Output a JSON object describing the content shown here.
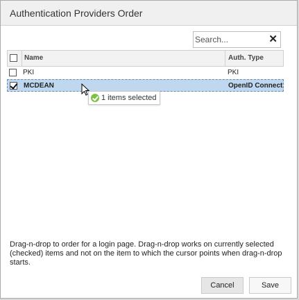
{
  "dialog": {
    "title": "Authentication Providers Order",
    "search_placeholder": "Search...",
    "clear_glyph": "✕"
  },
  "grid": {
    "columns": {
      "name": "Name",
      "type": "Auth. Type"
    },
    "rows": [
      {
        "name": "PKI",
        "type": "PKI",
        "checked": false
      },
      {
        "name": "MCDEAN",
        "type": "OpenID Connect",
        "checked": true
      }
    ]
  },
  "drag_tooltip": "1 items selected",
  "help_text": "Drag-n-drop to order for a login page. Drag-n-drop works on currently selected (checked) items and not on the item to which the cursor points when drag-n-drop starts.",
  "buttons": {
    "cancel": "Cancel",
    "save": "Save"
  },
  "colors": {
    "selected_row": "#bfd8ef",
    "ok_icon": "#7cc142"
  }
}
